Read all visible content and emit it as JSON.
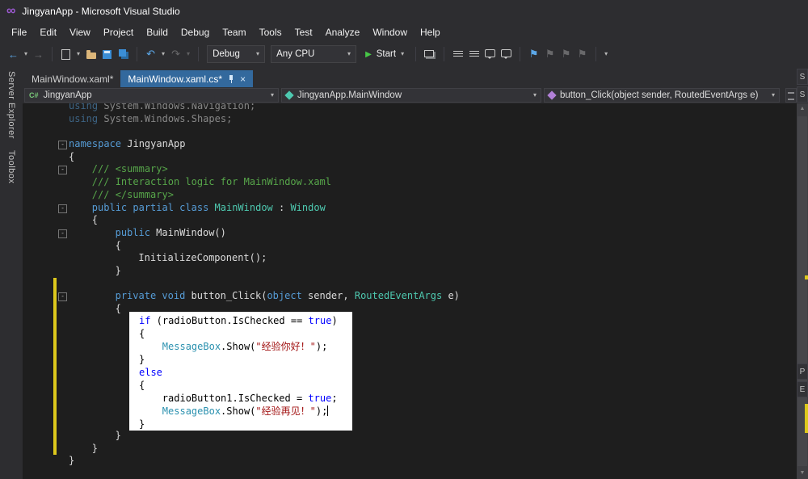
{
  "window": {
    "title": "JingyanApp - Microsoft Visual Studio"
  },
  "menu": {
    "items": [
      "File",
      "Edit",
      "View",
      "Project",
      "Build",
      "Debug",
      "Team",
      "Tools",
      "Test",
      "Analyze",
      "Window",
      "Help"
    ]
  },
  "toolbar": {
    "debug_config": "Debug",
    "platform": "Any CPU",
    "start_label": "Start"
  },
  "icons": {
    "caret": "▾",
    "close": "×",
    "back": "←",
    "forward": "→",
    "undo": "↶",
    "redo": "↷",
    "play": "▶",
    "scroll_up": "▲",
    "scroll_down": "▼",
    "flag": "⚑",
    "cs_project": "C#",
    "fold_collapse": "-"
  },
  "side_tabs": [
    "Server Explorer",
    "Toolbox"
  ],
  "tabs": [
    {
      "label": "MainWindow.xaml*",
      "active": false
    },
    {
      "label": "MainWindow.xaml.cs*",
      "active": true
    }
  ],
  "breadcrumbs": {
    "project": "JingyanApp",
    "type": "JingyanApp.MainWindow",
    "member": "button_Click(object sender, RoutedEventArgs e)"
  },
  "right_edge_tabs": [
    "S",
    "S",
    "P",
    "E"
  ],
  "editor": {
    "lines": [
      {
        "ind": 0,
        "dim": true,
        "tokens": [
          [
            "kw",
            "using"
          ],
          [
            "pl",
            " System.Windows.Navigation;"
          ]
        ]
      },
      {
        "ind": 0,
        "dim": true,
        "tokens": [
          [
            "kw",
            "using"
          ],
          [
            "pl",
            " System.Windows.Shapes;"
          ]
        ]
      },
      {
        "ind": 0,
        "tokens": []
      },
      {
        "ind": 0,
        "fold": true,
        "tokens": [
          [
            "kw",
            "namespace"
          ],
          [
            "pl",
            " JingyanApp"
          ]
        ]
      },
      {
        "ind": 0,
        "tokens": [
          [
            "pl",
            "{"
          ]
        ]
      },
      {
        "ind": 4,
        "fold": true,
        "tokens": [
          [
            "cm",
            "/// <summary>"
          ]
        ]
      },
      {
        "ind": 4,
        "tokens": [
          [
            "cm",
            "/// Interaction logic for MainWindow.xaml"
          ]
        ]
      },
      {
        "ind": 4,
        "tokens": [
          [
            "cm",
            "/// </summary>"
          ]
        ]
      },
      {
        "ind": 4,
        "fold": true,
        "tokens": [
          [
            "kw",
            "public partial class "
          ],
          [
            "ty",
            "MainWindow"
          ],
          [
            "pl",
            " : "
          ],
          [
            "ty",
            "Window"
          ]
        ]
      },
      {
        "ind": 4,
        "tokens": [
          [
            "pl",
            "{"
          ]
        ]
      },
      {
        "ind": 8,
        "fold": true,
        "tokens": [
          [
            "kw",
            "public"
          ],
          [
            "pl",
            " MainWindow()"
          ]
        ]
      },
      {
        "ind": 8,
        "tokens": [
          [
            "pl",
            "{"
          ]
        ]
      },
      {
        "ind": 12,
        "tokens": [
          [
            "pl",
            "InitializeComponent();"
          ]
        ]
      },
      {
        "ind": 8,
        "tokens": [
          [
            "pl",
            "}"
          ]
        ]
      },
      {
        "ind": 0,
        "chg": true,
        "tokens": []
      },
      {
        "ind": 8,
        "chg": true,
        "fold": true,
        "tokens": [
          [
            "kw",
            "private void"
          ],
          [
            "pl",
            " button_Click("
          ],
          [
            "kw",
            "object"
          ],
          [
            "pl",
            " sender, "
          ],
          [
            "ty",
            "RoutedEventArgs"
          ],
          [
            "pl",
            " e)"
          ]
        ]
      },
      {
        "ind": 8,
        "chg": true,
        "tokens": [
          [
            "pl",
            "{"
          ]
        ]
      },
      {
        "ind": 0,
        "chg": true,
        "tokens": []
      },
      {
        "ind": 0,
        "chg": true,
        "tokens": []
      },
      {
        "ind": 0,
        "chg": true,
        "tokens": []
      },
      {
        "ind": 0,
        "chg": true,
        "tokens": []
      },
      {
        "ind": 0,
        "chg": true,
        "tokens": []
      },
      {
        "ind": 0,
        "chg": true,
        "tokens": []
      },
      {
        "ind": 0,
        "chg": true,
        "tokens": []
      },
      {
        "ind": 0,
        "chg": true,
        "tokens": []
      },
      {
        "ind": 0,
        "chg": true,
        "tokens": []
      },
      {
        "ind": 8,
        "chg": true,
        "tokens": [
          [
            "pl",
            "}"
          ]
        ]
      },
      {
        "ind": 4,
        "chg": true,
        "tokens": [
          [
            "pl",
            "}"
          ]
        ]
      },
      {
        "ind": 0,
        "tokens": [
          [
            "pl",
            "}"
          ]
        ]
      }
    ],
    "overlay": {
      "lines": [
        {
          "ind": 0,
          "tokens": [
            [
              "kw",
              "if"
            ],
            [
              "pl",
              " (radioButton.IsChecked == "
            ],
            [
              "kw",
              "true"
            ],
            [
              "pl",
              ")"
            ]
          ]
        },
        {
          "ind": 0,
          "tokens": [
            [
              "pl",
              "{"
            ]
          ]
        },
        {
          "ind": 4,
          "tokens": [
            [
              "ty",
              "MessageBox"
            ],
            [
              "pl",
              ".Show("
            ],
            [
              "st",
              "\"经验你好！\""
            ],
            [
              "pl",
              ");"
            ]
          ]
        },
        {
          "ind": 0,
          "tokens": [
            [
              "pl",
              "}"
            ]
          ]
        },
        {
          "ind": 0,
          "tokens": [
            [
              "kw",
              "else"
            ]
          ]
        },
        {
          "ind": 0,
          "tokens": [
            [
              "pl",
              "{"
            ]
          ]
        },
        {
          "ind": 4,
          "tokens": [
            [
              "pl",
              "radioButton1.IsChecked = "
            ],
            [
              "kw",
              "true"
            ],
            [
              "pl",
              ";"
            ]
          ]
        },
        {
          "ind": 4,
          "tokens": [
            [
              "ty",
              "MessageBox"
            ],
            [
              "pl",
              ".Show("
            ],
            [
              "st",
              "\"经验再见！\""
            ],
            [
              "pl",
              ");"
            ],
            [
              "cz",
              ""
            ]
          ]
        },
        {
          "ind": 0,
          "tokens": [
            [
              "pl",
              "}"
            ]
          ]
        }
      ]
    }
  }
}
